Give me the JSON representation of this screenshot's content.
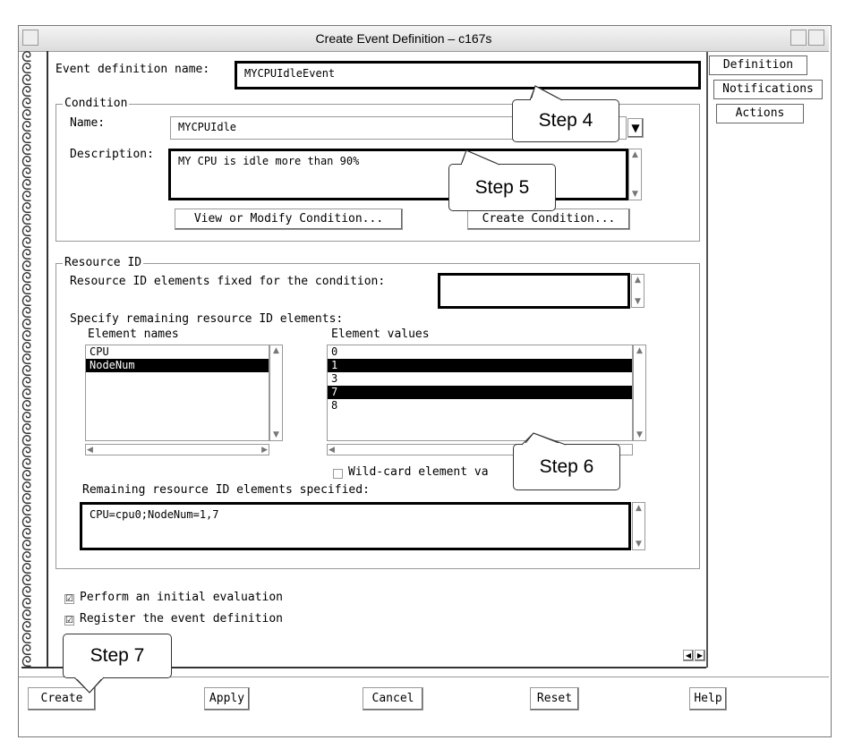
{
  "window": {
    "title": "Create Event Definition – c167s"
  },
  "event_definition": {
    "label": "Event definition name:",
    "value": "MYCPUIdleEvent"
  },
  "tabs": [
    "Definition",
    "Notifications",
    "Actions"
  ],
  "condition": {
    "legend": "Condition",
    "name_label": "Name:",
    "name_value": "MYCPUIdle",
    "description_label": "Description:",
    "description_value": "MY CPU is idle more than 90%",
    "view_button": "View or Modify Condition...",
    "create_button": "Create Condition..."
  },
  "resource": {
    "legend": "Resource ID",
    "fixed_label": "Resource ID elements fixed for the condition:",
    "fixed_value": "",
    "specify_label": "Specify remaining resource ID elements:",
    "names_header": "Element names",
    "values_header": "Element values",
    "names": [
      {
        "text": "CPU",
        "selected": false
      },
      {
        "text": "NodeNum",
        "selected": true
      }
    ],
    "values": [
      {
        "text": "0",
        "selected": false
      },
      {
        "text": "1",
        "selected": true
      },
      {
        "text": "3",
        "selected": false
      },
      {
        "text": "7",
        "selected": true
      },
      {
        "text": "8",
        "selected": false
      }
    ],
    "wildcard_label": "Wild-card element va",
    "remaining_label": "Remaining resource ID elements specified:",
    "remaining_value": "CPU=cpu0;NodeNum=1,7"
  },
  "options": {
    "initial_eval": "Perform an initial evaluation",
    "register": "Register the event definition"
  },
  "buttons": {
    "create": "Create",
    "apply": "Apply",
    "cancel": "Cancel",
    "reset": "Reset",
    "help": "Help"
  },
  "callouts": {
    "step4": "Step 4",
    "step5": "Step 5",
    "step6": "Step 6",
    "step7": "Step 7"
  },
  "icons": {
    "checked": "☑",
    "dropdown": "▼",
    "up": "▲",
    "down": "▼",
    "left": "◀",
    "right": "▶",
    "spiral": "ᘓ"
  }
}
